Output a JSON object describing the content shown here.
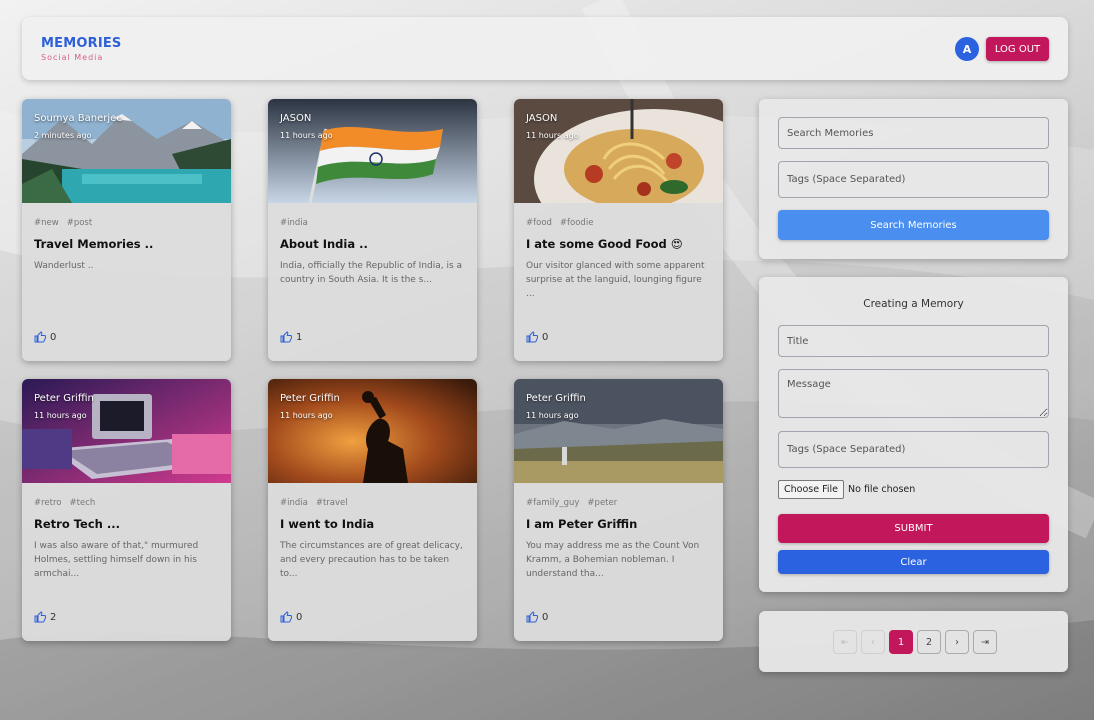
{
  "header": {
    "brand_title": "MEMORIES",
    "brand_subtitle": "Social Media",
    "avatar_initial": "A",
    "logout_label": "LOG OUT"
  },
  "posts": [
    {
      "author": "Soumya Banerjee",
      "time": "2 minutes ago",
      "tags": [
        "#new",
        "#post"
      ],
      "title": "Travel Memories ..",
      "message": "Wanderlust ..",
      "likes": "0",
      "image": "mountain-lake"
    },
    {
      "author": "JASON",
      "time": "11 hours ago",
      "tags": [
        "#india"
      ],
      "title": "About India ..",
      "message": "India, officially the Republic of India, is a country in South Asia. It is the s...",
      "likes": "1",
      "image": "india-flag"
    },
    {
      "author": "JASON",
      "time": "11 hours ago",
      "tags": [
        "#food",
        "#foodie"
      ],
      "title": "I ate some Good Food 😍",
      "message": "Our visitor glanced with some apparent surprise at the languid, lounging figure ...",
      "likes": "0",
      "image": "pasta"
    },
    {
      "author": "Peter Griffin",
      "time": "11 hours ago",
      "tags": [
        "#retro",
        "#tech"
      ],
      "title": "Retro Tech ...",
      "message": "I was also aware of that,\" murmured Holmes, settling himself down in his armchai...",
      "likes": "2",
      "image": "retro-computer"
    },
    {
      "author": "Peter Griffin",
      "time": "11 hours ago",
      "tags": [
        "#india",
        "#travel"
      ],
      "title": "I went to India",
      "message": "The circumstances are of great delicacy, and every precaution has to be taken to...",
      "likes": "0",
      "image": "fire-silhouette"
    },
    {
      "author": "Peter Griffin",
      "time": "11 hours ago",
      "tags": [
        "#family_guy",
        "#peter"
      ],
      "title": "I am Peter Griffin",
      "message": "You may address me as the Count Von Kramm, a Bohemian nobleman. I understand tha...",
      "likes": "0",
      "image": "landscape"
    }
  ],
  "search": {
    "search_placeholder": "Search Memories",
    "tags_placeholder": "Tags (Space Separated)",
    "button_label": "Search Memories"
  },
  "form": {
    "heading": "Creating a Memory",
    "title_placeholder": "Title",
    "message_placeholder": "Message",
    "tags_placeholder": "Tags (Space Separated)",
    "file_button": "Choose File",
    "file_status": "No file chosen",
    "submit_label": "SUBMIT",
    "clear_label": "Clear"
  },
  "pagination": {
    "first": "⇤",
    "prev": "‹",
    "pages": [
      "1",
      "2"
    ],
    "current": "1",
    "next": "›",
    "last": "⇥"
  },
  "colors": {
    "brand_blue": "#2d5fd9",
    "secondary_pink": "#c2185b",
    "search_button": "#4a8ff0",
    "clear_button": "#2a62e0"
  }
}
